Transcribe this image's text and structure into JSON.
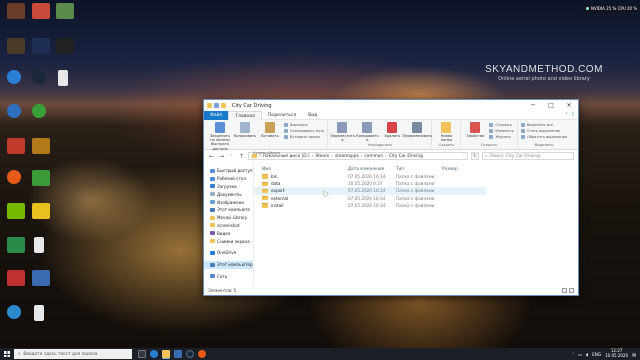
{
  "watermark": {
    "title": "SKYANDMETHOD.COM",
    "subtitle": "Online aerial photo and video library"
  },
  "hud": {
    "text": "NVIDIA 25 % CPU 20 %"
  },
  "window": {
    "title": "City Car Driving",
    "controls": {
      "minimize": "─",
      "maximize": "□",
      "close": "✕"
    }
  },
  "ribbon_tabs": {
    "file": "Файл",
    "home": "Главная",
    "share": "Поделиться",
    "view": "Вид"
  },
  "ribbon": {
    "clipboard": {
      "pin": "Закрепить на панели быстрого доступа",
      "copy": "Копировать",
      "paste": "Вставить",
      "small": [
        "Вырезать",
        "Скопировать путь",
        "Вставить ярлык"
      ],
      "group": "Буфер обмена"
    },
    "organize": {
      "move": "Переместить в",
      "copy_to": "Копировать в",
      "delete": "Удалить",
      "rename": "Переименовать",
      "group": "Упорядочить"
    },
    "new": {
      "new_folder": "Новая папка",
      "group": "Создать"
    },
    "open": {
      "properties": "Свойства",
      "small": [
        "Открыть",
        "Изменить",
        "Журнал"
      ],
      "group": "Открыть"
    },
    "select": {
      "small": [
        "Выделить все",
        "Снять выделение",
        "Обратить выделение"
      ],
      "group": "Выделить"
    }
  },
  "address": {
    "parts": [
      "Локальный диск (D:)",
      "Steam",
      "steamapps",
      "common",
      "City Car Driving"
    ],
    "search_placeholder": "Поиск: City Car Driving"
  },
  "nav_pane": [
    "Быстрый доступ",
    "Рабочий стол",
    "Загрузки",
    "Документы",
    "Изображени",
    "Этот компьюте",
    "Movavi Library",
    "screenshot",
    "Видео",
    "Снимки экрана",
    "OneDrive",
    "Этот компьютер",
    "Сеть"
  ],
  "columns": {
    "name": "Имя",
    "date": "Дата изменения",
    "type": "Тип",
    "size": "Размер"
  },
  "files": [
    {
      "name": "bin",
      "date": "07.05.2020 16:34",
      "type": "Папка с файлами"
    },
    {
      "name": "data",
      "date": "10.05.2020 0:27",
      "type": "Папка с файлами"
    },
    {
      "name": "export",
      "date": "07.05.2020 16:34",
      "type": "Папка с файлами"
    },
    {
      "name": "external",
      "date": "07.05.2020 16:34",
      "type": "Папка с файлами"
    },
    {
      "name": "install",
      "date": "07.05.2020 16:34",
      "type": "Папка с файлами"
    }
  ],
  "status": {
    "items": "Элементов: 5"
  },
  "taskbar": {
    "search_placeholder": "Введите здесь текст для поиска",
    "lang": "ENG",
    "time": "12:27",
    "date": "10.05.2020"
  },
  "colors": {
    "accent": "#1979ca",
    "folder": "#f3c25a",
    "selection": "#cce8ff",
    "taskbar": "#1b1f27"
  }
}
